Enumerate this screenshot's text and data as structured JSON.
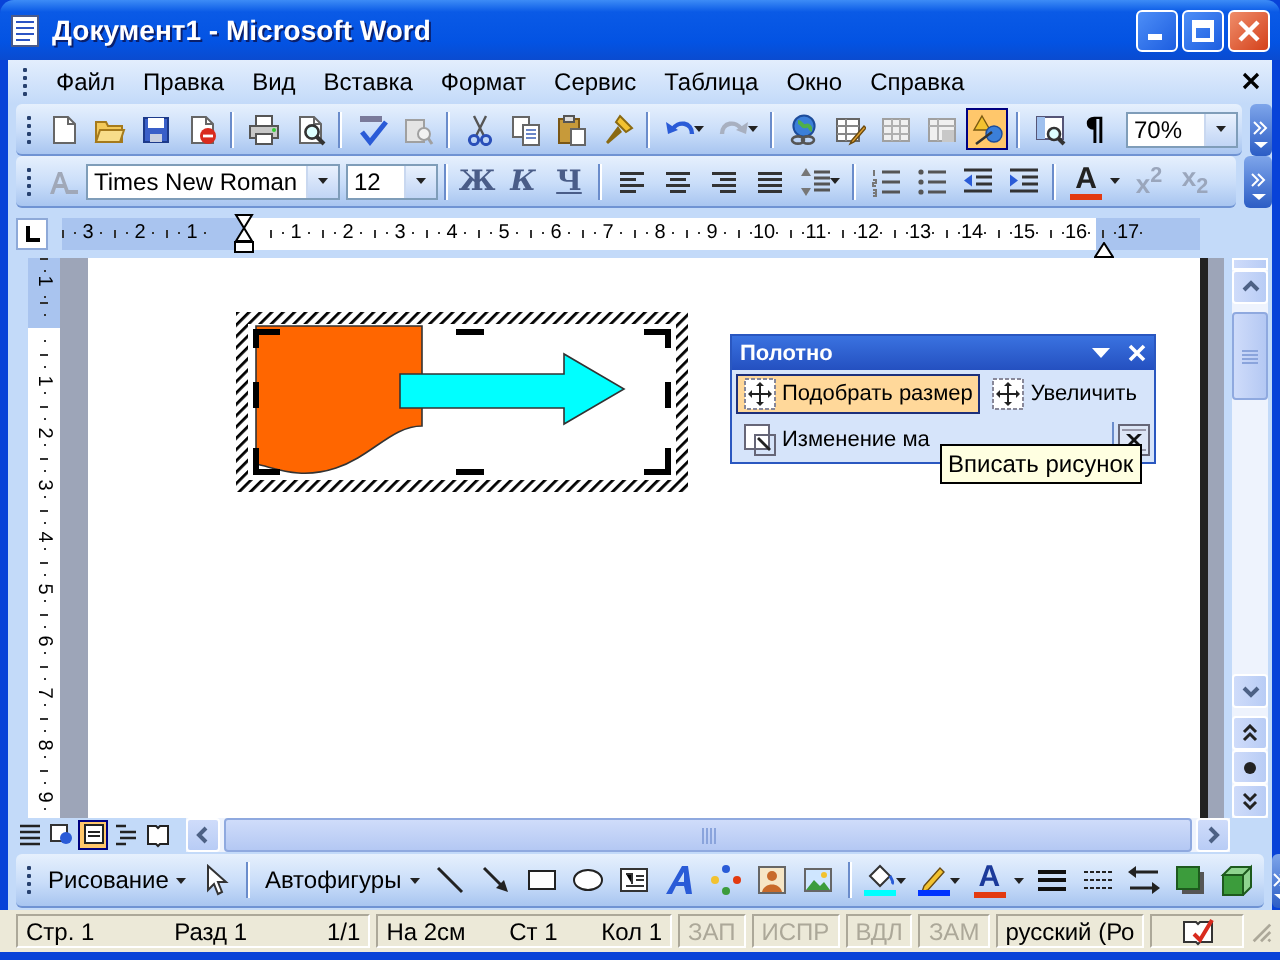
{
  "window": {
    "title": "Документ1 - Microsoft Word"
  },
  "menu": {
    "items": [
      "Файл",
      "Правка",
      "Вид",
      "Вставка",
      "Формат",
      "Сервис",
      "Таблица",
      "Окно",
      "Справка"
    ]
  },
  "standard_toolbar": {
    "drawing_selected": true,
    "pilcrow": "¶",
    "zoom": "70%"
  },
  "formatting_toolbar": {
    "font": "Times New Roman",
    "size": "12",
    "bold": "Ж",
    "italic": "К",
    "underline": "Ч",
    "font_color": "A",
    "superscript": "x$^{2}$",
    "subscript": "x$_{2}$"
  },
  "ruler": {
    "left_numbers": [
      "3",
      "2",
      "1"
    ],
    "numbers": [
      "1",
      "2",
      "3",
      "4",
      "5",
      "6",
      "7",
      "8",
      "9",
      "10",
      "11",
      "12",
      "13",
      "14",
      "15",
      "16",
      "17"
    ]
  },
  "vertical_ruler": {
    "numbers": [
      "1",
      "1",
      "2",
      "3",
      "4",
      "5",
      "6",
      "7",
      "8",
      "9"
    ]
  },
  "canvas_toolbar": {
    "title": "Полотно",
    "buttons": [
      {
        "label": "Подобрать размер",
        "selected": true
      },
      {
        "label": "Увеличить",
        "selected": false
      }
    ],
    "scale_button": "Изменение ма",
    "tooltip": "Вписать рисунок"
  },
  "view_buttons": [
    {
      "selected": false
    },
    {
      "selected": false
    },
    {
      "selected": true
    },
    {
      "selected": false
    },
    {
      "selected": false
    }
  ],
  "drawing_toolbar": {
    "draw_menu": "Рисование",
    "autoshapes": "Автофигуры",
    "font_color": "A"
  },
  "status_bar": {
    "page_info": [
      "Стр. 1",
      "Разд 1",
      "1/1"
    ],
    "position_info": [
      "На 2см",
      "Ст 1",
      "Кол 1"
    ],
    "indicators": [
      {
        "label": "ЗАП",
        "disabled": true
      },
      {
        "label": "ИСПР",
        "disabled": true
      },
      {
        "label": "ВДЛ",
        "disabled": true
      },
      {
        "label": "ЗАМ",
        "disabled": true
      }
    ],
    "language": "русский (Ро"
  }
}
